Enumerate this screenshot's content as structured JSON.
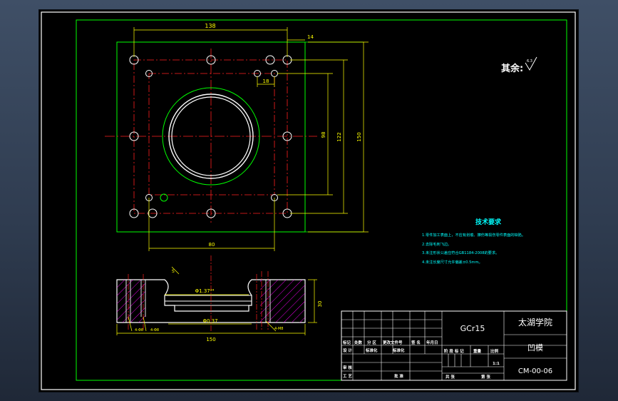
{
  "drawing": {
    "material": "GCr15",
    "school": "太湖学院",
    "part_name": "凹模",
    "drawing_number": "CM-00-06",
    "surface_note": "其余:",
    "roughness_mark": "6.3",
    "tech_title": "技术要求",
    "tech_requirements": [
      "1.零件加工表面上，不应有划痕、擦伤等损伤零件表面的缺陷。",
      "2.去除毛刺飞边。",
      "3.未注形状公差应符合GB1184-2008的要求。",
      "4.未注长度尺寸允许偏差±0.5mm。"
    ],
    "title_block_labels": {
      "mark": "标记",
      "count": "处数",
      "zone": "分 区",
      "change_doc": "更改文件号",
      "sign": "签 名",
      "date": "年月日",
      "design": "设 计",
      "standardize": "标准化",
      "stage_mark": "阶 段 标 记",
      "weight": "重量",
      "scale": "比例",
      "scale_value": "1:1",
      "review": "审 核",
      "process": "工 艺",
      "approve": "批 准",
      "sheets_total": "共 张",
      "sheet_no": "第 张",
      "date_stamp": "年月日"
    }
  },
  "dimensions": {
    "top_overall_width": "138",
    "top_right_offset": "14",
    "inner_hole_pitch": "18",
    "height_inner": "98",
    "height_mid": "122",
    "height_overall": "150",
    "bottom_width": "80",
    "section_bore": "Φ1.37²⁴",
    "section_thickness": "30",
    "section_bottom_bore": "Φ0.37",
    "section_overall_width": "150",
    "section_left_small_a": "4-Φ8",
    "section_left_small_b": "4-Φ8",
    "section_right_thread": "4-M8",
    "section_callout": "S"
  },
  "colors": {
    "frame": "#00ff00",
    "dimension": "#ffff00",
    "part_outline": "#ffffff",
    "centerline": "#ff2020",
    "hatch": "#ff00ff",
    "text": "#00ffff",
    "holes": "#ffff66"
  }
}
